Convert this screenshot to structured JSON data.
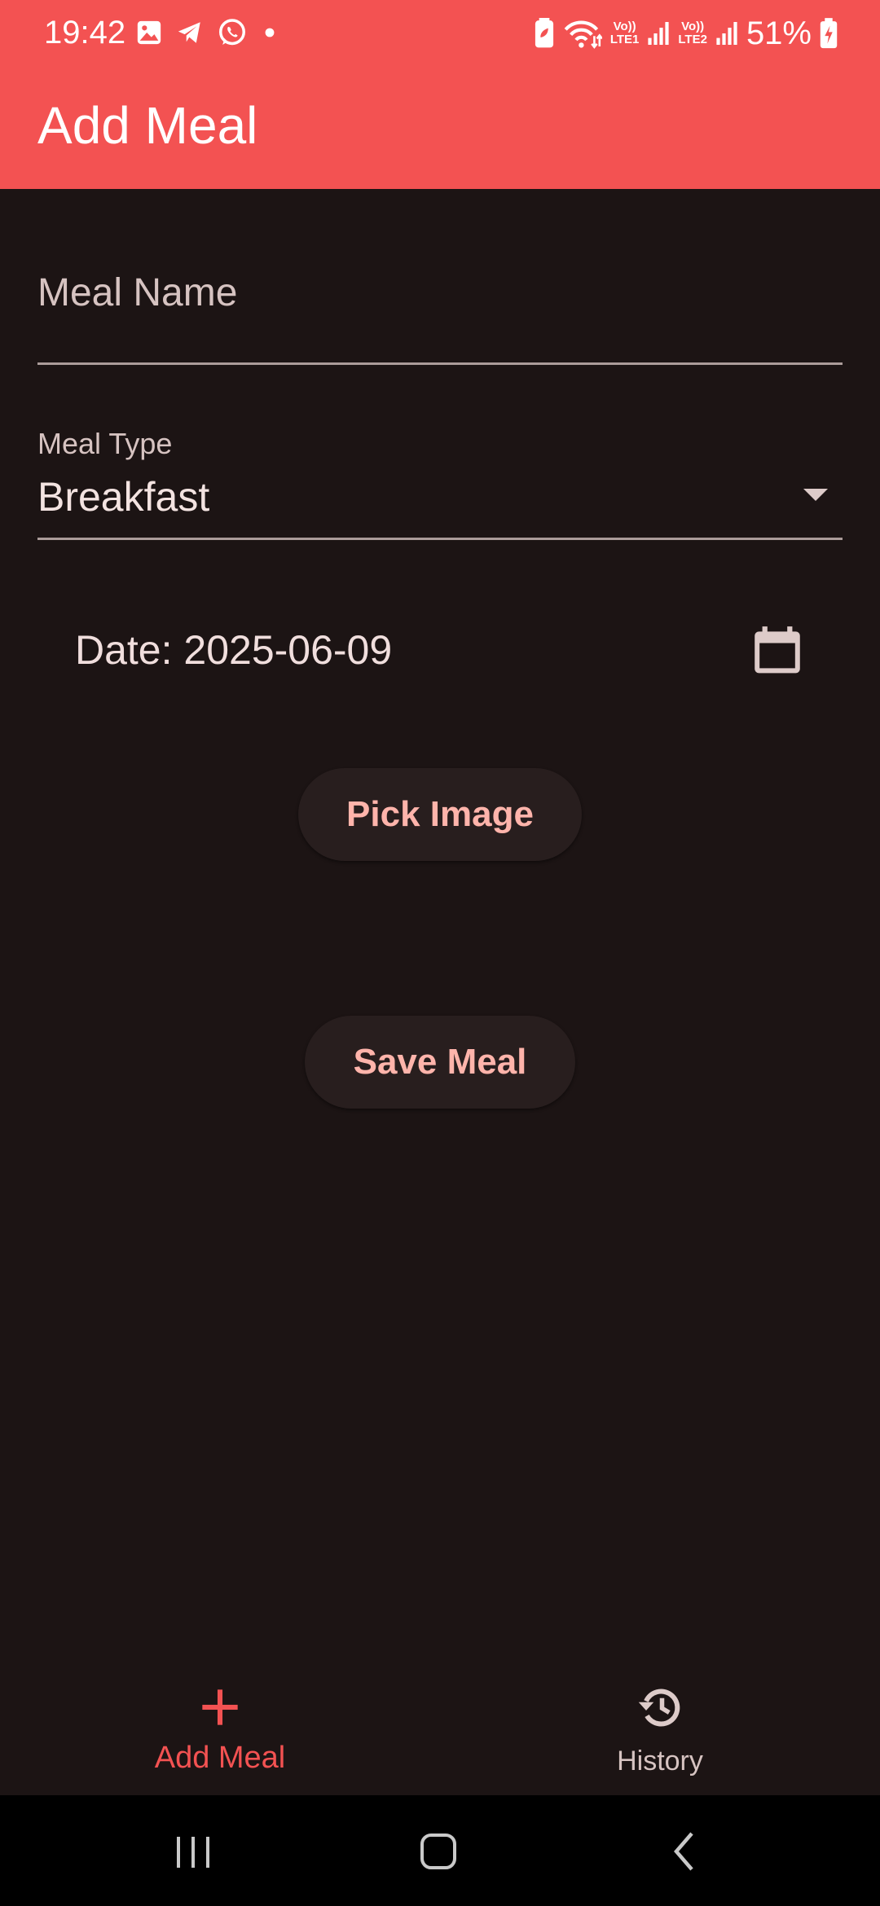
{
  "status_bar": {
    "time": "19:42",
    "left_icons": [
      "gallery-icon",
      "telegram-icon",
      "whatsapp-icon",
      "dot-icon"
    ],
    "right_icons": [
      "battery-saver-icon",
      "wifi-icon",
      "volte-lte1-icon",
      "signal-icon",
      "volte-lte2-icon",
      "signal-icon",
      "battery-icon"
    ],
    "lte1_label": "LTE1",
    "lte2_label": "LTE2",
    "volte_label": "Vo))",
    "battery": "51%"
  },
  "app_bar": {
    "title": "Add Meal",
    "color": "#f35252"
  },
  "form": {
    "meal_name": {
      "placeholder": "Meal Name",
      "value": ""
    },
    "meal_type": {
      "label": "Meal Type",
      "value": "Breakfast"
    },
    "date": {
      "text": "Date: 2025-06-09"
    },
    "pick_image_label": "Pick Image",
    "save_label": "Save Meal"
  },
  "bottom_nav": {
    "items": [
      {
        "label": "Add Meal",
        "icon": "plus-icon",
        "selected": true
      },
      {
        "label": "History",
        "icon": "history-icon",
        "selected": false
      }
    ]
  },
  "colors": {
    "accent": "#f35252",
    "background": "#1c1414",
    "button_text": "#ffb4ab",
    "button_bg": "#281e1e"
  }
}
